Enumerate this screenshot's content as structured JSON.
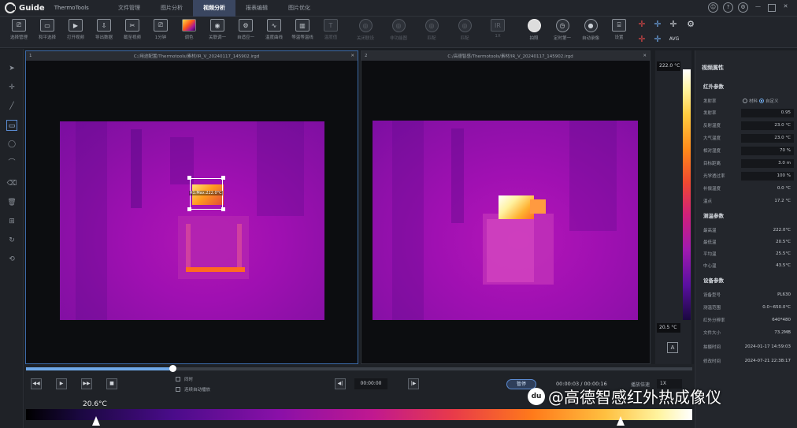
{
  "app": {
    "brand": "Guide",
    "name": "ThermoTools"
  },
  "menu": [
    {
      "label": "文件管理"
    },
    {
      "label": "图片分析"
    },
    {
      "label": "视频分析",
      "active": true
    },
    {
      "label": "报表编辑"
    },
    {
      "label": "图片优化"
    }
  ],
  "toolbar": {
    "items": [
      {
        "label": "选择管理",
        "icon": "monitor-icon"
      },
      {
        "label": "和平选择",
        "icon": "screen-icon"
      },
      {
        "label": "打开视频",
        "icon": "open-video-icon"
      },
      {
        "label": "导出数据",
        "icon": "export-data-icon"
      },
      {
        "label": "截至视频",
        "icon": "cut-video-icon"
      },
      {
        "label": "1分钟",
        "icon": "duration-icon"
      },
      {
        "label": "调色",
        "icon": "palette-icon"
      },
      {
        "label": "关联调一",
        "icon": "link-icon"
      },
      {
        "label": "自适应一",
        "icon": "adapt-icon"
      },
      {
        "label": "温度曲线",
        "icon": "curve-icon"
      },
      {
        "label": "等温等温线",
        "icon": "isotherm-icon"
      },
      {
        "label": "温度值",
        "icon": "temp-value-icon"
      },
      {
        "label": "关闭联设",
        "icon": "close-link-icon"
      },
      {
        "label": "非功能图",
        "icon": "nonfunc-icon"
      },
      {
        "label": "匹配",
        "icon": "match-icon"
      },
      {
        "label": "匹配",
        "icon": "match2-icon"
      },
      {
        "label": "1X",
        "icon": "zoom-1x-icon"
      },
      {
        "label": "拍照",
        "icon": "capture-icon"
      },
      {
        "label": "定时第一",
        "icon": "timer-icon"
      },
      {
        "label": "自动录像",
        "icon": "auto-record-icon"
      },
      {
        "label": "设置",
        "icon": "camera-icon"
      },
      {
        "label": "AVG",
        "icon": "avg-icon"
      }
    ]
  },
  "panes": [
    {
      "num": "1",
      "path": "C:/用途配置/Thermotools/素材/IR_V_20240117_145902.irgd",
      "roi_label": "R1:Max:222.0°C"
    },
    {
      "num": "2",
      "path": "C:/高德智感/Thermotools/素材/IR_V_20240117_145902.irgd"
    }
  ],
  "colorbar": {
    "max": "222.0 °C",
    "min": "20.5 °C",
    "button": "A"
  },
  "rightpanel": {
    "title": "视频属性",
    "ir_section": "红外参数",
    "emissivity_label": "发射率",
    "emissivity_opts": [
      "材料",
      "自定义"
    ],
    "ir_rows": [
      {
        "k": "发射率",
        "v": "0.95"
      },
      {
        "k": "反射温度",
        "v": "23.0 °C"
      },
      {
        "k": "大气温度",
        "v": "23.0 °C"
      },
      {
        "k": "相对湿度",
        "v": "70 %"
      },
      {
        "k": "目标距离",
        "v": "3.0 m"
      },
      {
        "k": "光学透过率",
        "v": "100 %"
      },
      {
        "k": "补偿温度",
        "v": "0.0 °C"
      },
      {
        "k": "温点",
        "v": "17.2 °C"
      }
    ],
    "temp_section": "测温参数",
    "temp_rows": [
      {
        "k": "最高温",
        "v": "222.0°C"
      },
      {
        "k": "最低温",
        "v": "20.5°C"
      },
      {
        "k": "平均温",
        "v": "25.5°C"
      },
      {
        "k": "中心温",
        "v": "43.5°C"
      }
    ],
    "dev_section": "设备参数",
    "dev_rows": [
      {
        "k": "设备型号",
        "v": "PL630"
      },
      {
        "k": "测温范围",
        "v": "0.0~650.0°C"
      },
      {
        "k": "红外分辨率",
        "v": "640*480"
      },
      {
        "k": "文件大小",
        "v": "73.2MB"
      },
      {
        "k": "拍摄时间",
        "v": "2024-01-17 14:59:03"
      },
      {
        "k": "修改时间",
        "v": "2024-07-21 22:38:17"
      }
    ]
  },
  "playback": {
    "progress": 0.22,
    "sync_label": "同时",
    "autoplay_label": "连续自动播放",
    "current_time": "00:00:00",
    "pause_label": "暂停",
    "time_display": "00:00:03 / 00:00:16",
    "speed_label": "播放倍速",
    "speed_value": "1X",
    "grad_min": "20.6°C"
  },
  "watermark": "@高德智感红外热成像仪"
}
